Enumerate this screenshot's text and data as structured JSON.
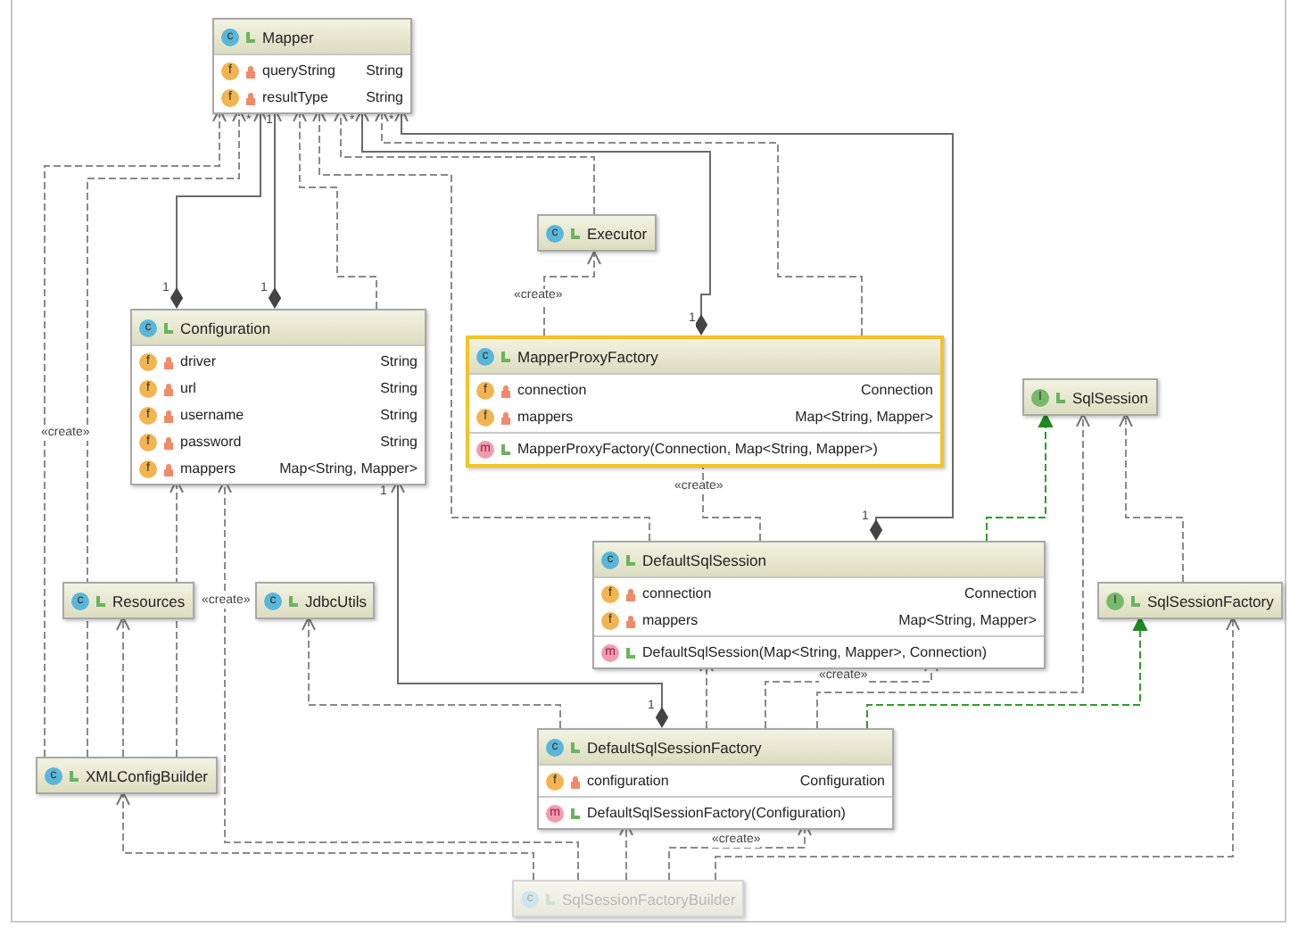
{
  "diagram": {
    "nodes": [
      {
        "kind": "class",
        "badge": "c",
        "name": "Mapper",
        "selected": false,
        "disabled": false,
        "fields": [
          {
            "badge": "f",
            "name": "queryString",
            "type": "String"
          },
          {
            "badge": "f",
            "name": "resultType",
            "type": "String"
          }
        ]
      },
      {
        "kind": "class",
        "badge": "c",
        "name": "Executor",
        "selected": false,
        "disabled": false
      },
      {
        "kind": "class",
        "badge": "c",
        "name": "Configuration",
        "selected": false,
        "disabled": false,
        "fields": [
          {
            "badge": "f",
            "name": "driver",
            "type": "String"
          },
          {
            "badge": "f",
            "name": "url",
            "type": "String"
          },
          {
            "badge": "f",
            "name": "username",
            "type": "String"
          },
          {
            "badge": "f",
            "name": "password",
            "type": "String"
          },
          {
            "badge": "f",
            "name": "mappers",
            "type": "Map<String, Mapper>"
          }
        ]
      },
      {
        "kind": "class",
        "badge": "c",
        "name": "MapperProxyFactory",
        "selected": true,
        "disabled": false,
        "fields": [
          {
            "badge": "f",
            "name": "connection",
            "type": "Connection"
          },
          {
            "badge": "f",
            "name": "mappers",
            "type": "Map<String, Mapper>"
          }
        ],
        "methods": [
          {
            "badge": "m",
            "signature": "MapperProxyFactory(Connection, Map<String, Mapper>)"
          }
        ]
      },
      {
        "kind": "interface",
        "badge": "I",
        "name": "SqlSession",
        "selected": false,
        "disabled": false
      },
      {
        "kind": "class",
        "badge": "c",
        "name": "Resources",
        "selected": false,
        "disabled": false
      },
      {
        "kind": "class",
        "badge": "c",
        "name": "JdbcUtils",
        "selected": false,
        "disabled": false
      },
      {
        "kind": "class",
        "badge": "c",
        "name": "DefaultSqlSession",
        "selected": false,
        "disabled": false,
        "fields": [
          {
            "badge": "f",
            "name": "connection",
            "type": "Connection"
          },
          {
            "badge": "f",
            "name": "mappers",
            "type": "Map<String, Mapper>"
          }
        ],
        "methods": [
          {
            "badge": "m",
            "signature": "DefaultSqlSession(Map<String, Mapper>, Connection)"
          }
        ]
      },
      {
        "kind": "interface",
        "badge": "I",
        "name": "SqlSessionFactory",
        "selected": false,
        "disabled": false
      },
      {
        "kind": "class",
        "badge": "c",
        "name": "XMLConfigBuilder",
        "selected": false,
        "disabled": false
      },
      {
        "kind": "class",
        "badge": "c",
        "name": "DefaultSqlSessionFactory",
        "selected": false,
        "disabled": false,
        "fields": [
          {
            "badge": "f",
            "name": "configuration",
            "type": "Configuration"
          }
        ],
        "methods": [
          {
            "badge": "m",
            "signature": "DefaultSqlSessionFactory(Configuration)"
          }
        ]
      },
      {
        "kind": "class",
        "badge": "c",
        "name": "SqlSessionFactoryBuilder",
        "selected": false,
        "disabled": true
      }
    ],
    "connectors": [
      {
        "kind": "dependency",
        "labels": [
          "«create»"
        ]
      },
      {
        "kind": "dependency",
        "labels": [
          "*"
        ]
      },
      {
        "kind": "composition",
        "labels": [
          "1",
          "1"
        ]
      },
      {
        "kind": "composition",
        "labels": [
          "1"
        ]
      },
      {
        "kind": "dependency"
      },
      {
        "kind": "dependency"
      },
      {
        "kind": "dependency"
      },
      {
        "kind": "composition",
        "labels": [
          "*",
          "1"
        ]
      },
      {
        "kind": "dependency"
      },
      {
        "kind": "composition",
        "labels": [
          "*",
          "1"
        ]
      },
      {
        "kind": "dependency",
        "labels": [
          "«create»"
        ]
      },
      {
        "kind": "dependency",
        "labels": [
          "«create»"
        ]
      },
      {
        "kind": "realization"
      },
      {
        "kind": "dependency"
      },
      {
        "kind": "dependency"
      },
      {
        "kind": "realization"
      },
      {
        "kind": "dependency"
      },
      {
        "kind": "dependency",
        "labels": [
          "«create»"
        ]
      },
      {
        "kind": "dependency"
      },
      {
        "kind": "dependency",
        "labels": [
          "«create»"
        ]
      },
      {
        "kind": "dependency"
      },
      {
        "kind": "dependency"
      },
      {
        "kind": "dependency",
        "labels": [
          "«create»"
        ]
      },
      {
        "kind": "dependency"
      },
      {
        "kind": "dependency"
      },
      {
        "kind": "composition",
        "labels": [
          "1",
          "1"
        ]
      },
      {
        "kind": "dependency"
      }
    ]
  }
}
